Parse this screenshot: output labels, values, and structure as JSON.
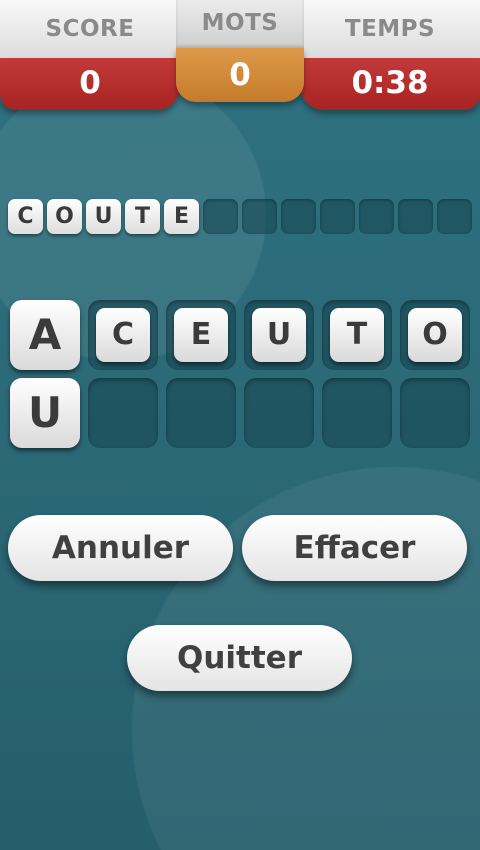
{
  "header": {
    "score": {
      "label": "SCORE",
      "value": "0"
    },
    "words": {
      "label": "MOTS",
      "value": "0"
    },
    "time": {
      "label": "TEMPS",
      "value": "0:38"
    }
  },
  "answer": {
    "letters": [
      "C",
      "O",
      "U",
      "T",
      "E"
    ],
    "empty_slots": 7
  },
  "grid": {
    "row1": [
      {
        "letter": "A",
        "state": "active"
      },
      {
        "letter": "C",
        "state": "used"
      },
      {
        "letter": "E",
        "state": "used"
      },
      {
        "letter": "U",
        "state": "used"
      },
      {
        "letter": "T",
        "state": "used"
      },
      {
        "letter": "O",
        "state": "used"
      }
    ],
    "row2": [
      {
        "letter": "U",
        "state": "active"
      },
      {
        "letter": "",
        "state": "empty"
      },
      {
        "letter": "",
        "state": "empty"
      },
      {
        "letter": "",
        "state": "empty"
      },
      {
        "letter": "",
        "state": "empty"
      },
      {
        "letter": "",
        "state": "empty"
      }
    ]
  },
  "buttons": {
    "cancel": "Annuler",
    "clear": "Effacer",
    "quit": "Quitter"
  },
  "colors": {
    "background": "#2c6a78",
    "score_red": "#b52e2e",
    "words_orange": "#d48b3a"
  }
}
